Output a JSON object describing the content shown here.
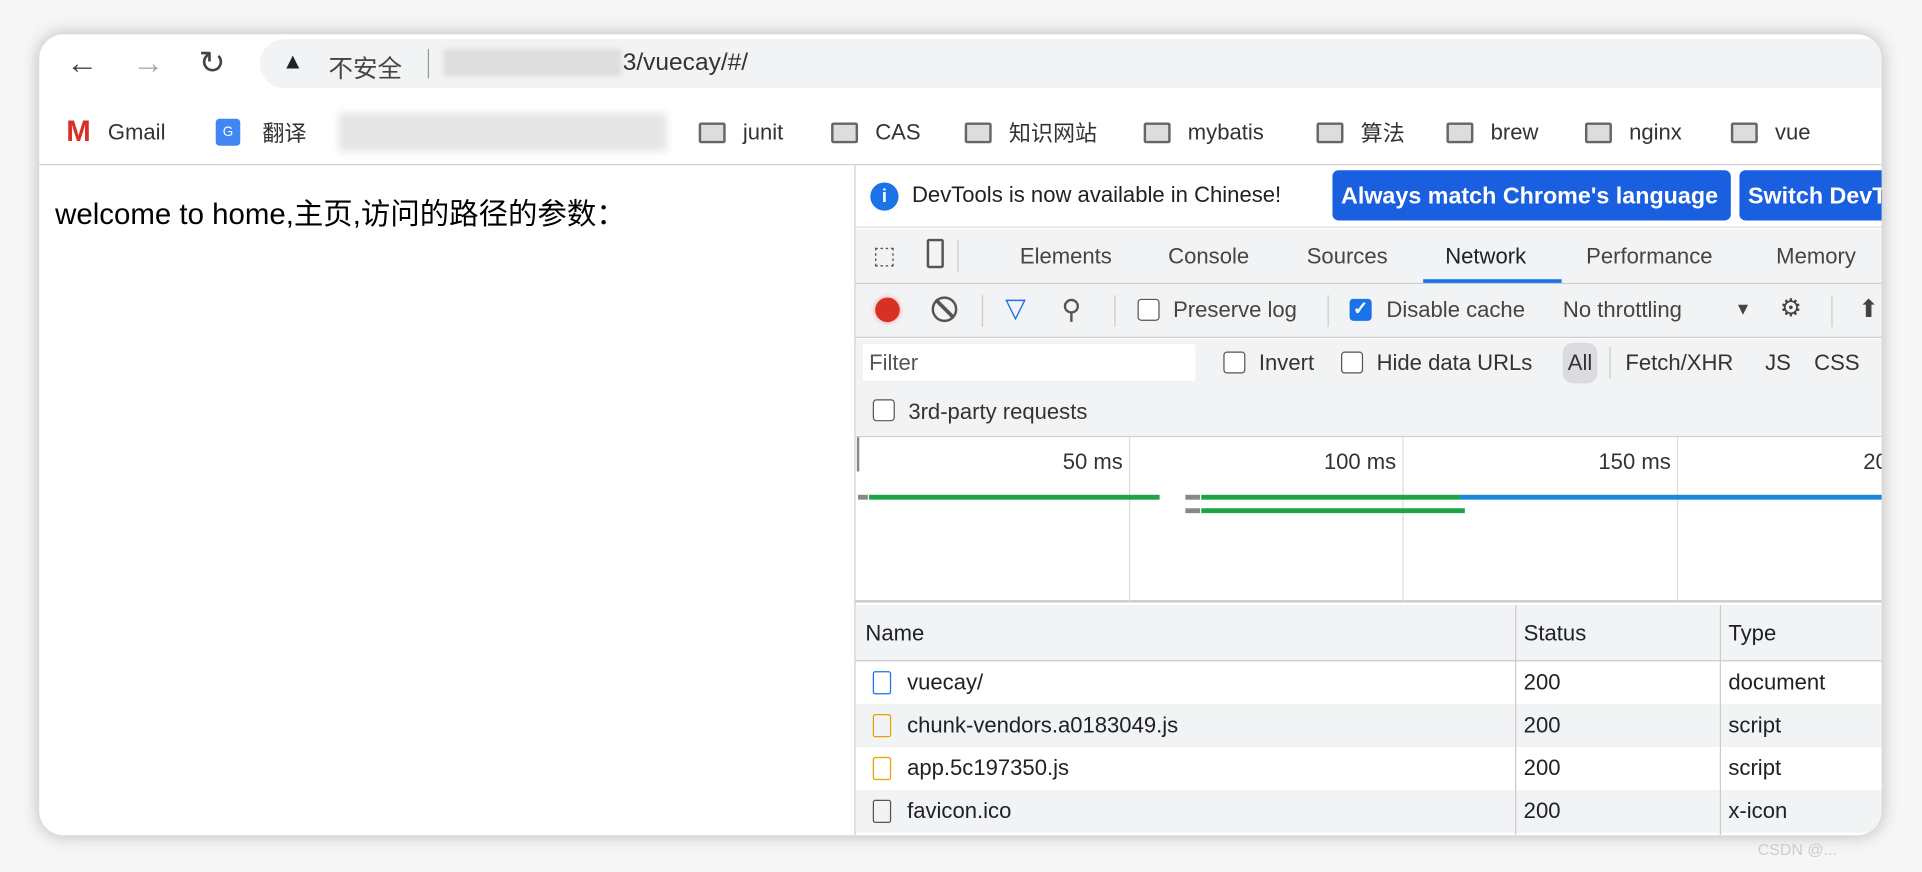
{
  "browser": {
    "security_label": "不安全",
    "url_suffix": "3/vuecay/#/",
    "bookmarks": [
      {
        "label": "Gmail",
        "icon": "gmail-icon"
      },
      {
        "label": "翻译",
        "icon": "translate-icon"
      },
      {
        "label": "junit",
        "icon": "folder-icon"
      },
      {
        "label": "CAS",
        "icon": "folder-icon"
      },
      {
        "label": "知识网站",
        "icon": "folder-icon"
      },
      {
        "label": "mybatis",
        "icon": "folder-icon"
      },
      {
        "label": "算法",
        "icon": "folder-icon"
      },
      {
        "label": "brew",
        "icon": "folder-icon"
      },
      {
        "label": "nginx",
        "icon": "folder-icon"
      },
      {
        "label": "vue",
        "icon": "folder-icon"
      }
    ]
  },
  "page": {
    "message": "welcome to home,主页,访问的路径的参数："
  },
  "devtools": {
    "banner": {
      "text": "DevTools is now available in Chinese!",
      "btn_match": "Always match Chrome's language",
      "btn_switch": "Switch DevTools to Chinese"
    },
    "tabs": [
      "Elements",
      "Console",
      "Sources",
      "Network",
      "Performance",
      "Memory"
    ],
    "active_tab": "Network",
    "toolbar": {
      "preserve_log": "Preserve log",
      "preserve_log_checked": false,
      "disable_cache": "Disable cache",
      "disable_cache_checked": true,
      "throttling": "No throttling"
    },
    "filter": {
      "placeholder": "Filter",
      "invert": "Invert",
      "hide_data_urls": "Hide data URLs",
      "types": [
        "All",
        "Fetch/XHR",
        "JS",
        "CSS"
      ],
      "third_party": "3rd-party requests"
    },
    "timeline": {
      "ticks": [
        "50 ms",
        "100 ms",
        "150 ms",
        "20"
      ]
    },
    "table": {
      "headers": [
        "Name",
        "Status",
        "Type"
      ],
      "rows": [
        {
          "name": "vuecay/",
          "status": "200",
          "type": "document",
          "icon": "document-icon"
        },
        {
          "name": "chunk-vendors.a0183049.js",
          "status": "200",
          "type": "script",
          "icon": "script-icon"
        },
        {
          "name": "app.5c197350.js",
          "status": "200",
          "type": "script",
          "icon": "script-icon"
        },
        {
          "name": "favicon.ico",
          "status": "200",
          "type": "x-icon",
          "icon": "file-icon"
        }
      ]
    }
  },
  "colors": {
    "accent": "#1a73e8",
    "record": "#d93025",
    "waiting": "#1ea446",
    "download": "#1a88d8"
  },
  "watermark": "CSDN @..."
}
